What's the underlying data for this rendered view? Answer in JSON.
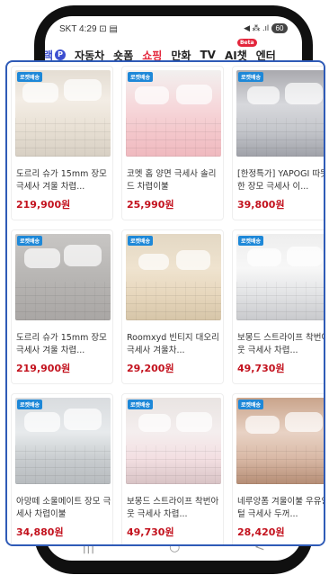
{
  "statusbar": {
    "left": "SKT 4:29 ⊡ ▤",
    "right_icons": "◀ ⁂ .ıl",
    "battery": "60"
  },
  "tabs": [
    {
      "label": "랙",
      "icon": "circle-p-icon",
      "active": false
    },
    {
      "label": "자동차",
      "active": false
    },
    {
      "label": "숏폼",
      "active": false
    },
    {
      "label": "쇼핑",
      "active": true
    },
    {
      "label": "만화",
      "active": false
    },
    {
      "label": "TV",
      "active": false
    },
    {
      "label": "AI챗",
      "badge": "Beta",
      "active": false
    },
    {
      "label": "엔터",
      "active": false
    }
  ],
  "badge_label": "로켓배송",
  "products": [
    {
      "title": "도르리 슈가 15mm 장모 극세사 겨울 차렵...",
      "price": "219,900원",
      "thumb_style": "cream"
    },
    {
      "title": "코멧 홈 양면 극세사 솔리드 차렵이불",
      "price": "25,990원",
      "thumb_style": "pink"
    },
    {
      "title": "[한정특가] YAPOGI 따뜻한 장모 극세사 이...",
      "price": "39,800원",
      "thumb_style": "grey"
    },
    {
      "title": "도르리 슈가 15mm 장모 극세사 겨울 차렵...",
      "price": "219,900원",
      "thumb_style": "stone"
    },
    {
      "title": "Roomxyd 빈티지 대오리 극세사 겨울차...",
      "price": "29,200원",
      "thumb_style": "warm"
    },
    {
      "title": "보몽드 스트라이프 착번아웃 극세사 차렵...",
      "price": "49,730원",
      "thumb_style": "white"
    },
    {
      "title": "아망떼 소울메이트 장모 극세사 차렵이불",
      "price": "34,880원",
      "thumb_style": "ice"
    },
    {
      "title": "보몽드 스트라이프 착번아웃 극세사 차렵...",
      "price": "49,730원",
      "thumb_style": "blush"
    },
    {
      "title": "네루앙폼 겨울이불 우유양털 극세사 두꺼...",
      "price": "28,420원",
      "thumb_style": "floral"
    }
  ],
  "navbar": {
    "recent": "|||",
    "home": "○",
    "back": "<"
  },
  "colors": {
    "accent_red": "#e3263c",
    "price_red": "#c3121e",
    "badge_blue": "#1e88d8",
    "panel_border": "#2f5bb7"
  }
}
